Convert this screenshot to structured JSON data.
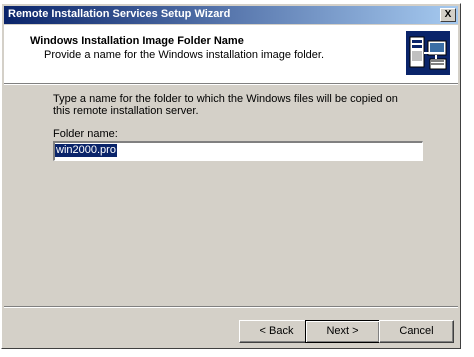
{
  "window": {
    "title": "Remote Installation Services Setup Wizard",
    "close_label": "X"
  },
  "header": {
    "title": "Windows Installation Image Folder Name",
    "subtitle": "Provide a name for the Windows installation image folder.",
    "icon": "wizard-icon"
  },
  "body": {
    "instructions": "Type a name for the folder to which the Windows files will be copied on this remote installation server.",
    "field_label": "Folder name:",
    "folder_value": "win2000.pro"
  },
  "buttons": {
    "back_label": "< Back",
    "next_label": "Next >",
    "cancel_label": "Cancel"
  },
  "colors": {
    "title_bar": "#0a246a",
    "dialog_face": "#d4d0c8",
    "selection": "#0a246a"
  }
}
